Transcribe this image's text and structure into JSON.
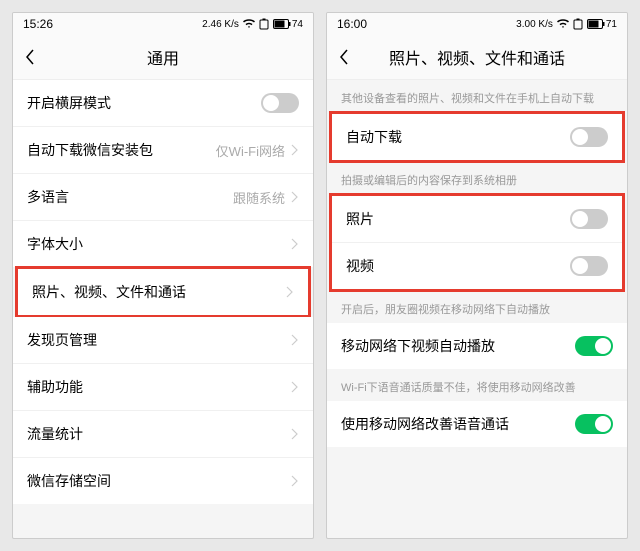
{
  "left": {
    "time": "15:26",
    "net_label": "2.46 K/s",
    "battery": "74",
    "title": "通用",
    "rows": {
      "landscape": "开启横屏模式",
      "auto_download_wx": "自动下载微信安装包",
      "auto_download_wx_value": "仅Wi-Fi网络",
      "multilang": "多语言",
      "multilang_value": "跟随系统",
      "font_size": "字体大小",
      "media_call": "照片、视频、文件和通话",
      "discover": "发现页管理",
      "accessibility": "辅助功能",
      "traffic": "流量统计",
      "storage": "微信存储空间"
    }
  },
  "right": {
    "time": "16:00",
    "net_label": "3.00 K/s",
    "battery": "71",
    "title": "照片、视频、文件和通话",
    "sections": {
      "s1": "其他设备查看的照片、视频和文件在手机上自动下载",
      "auto_dl": "自动下载",
      "s2": "拍摄或编辑后的内容保存到系统相册",
      "photo": "照片",
      "video": "视频",
      "s3": "开启后，朋友圈视频在移动网络下自动播放",
      "autoplay": "移动网络下视频自动播放",
      "s4": "Wi-Fi下语音通话质量不佳，将使用移动网络改善",
      "voip": "使用移动网络改善语音通话"
    }
  }
}
